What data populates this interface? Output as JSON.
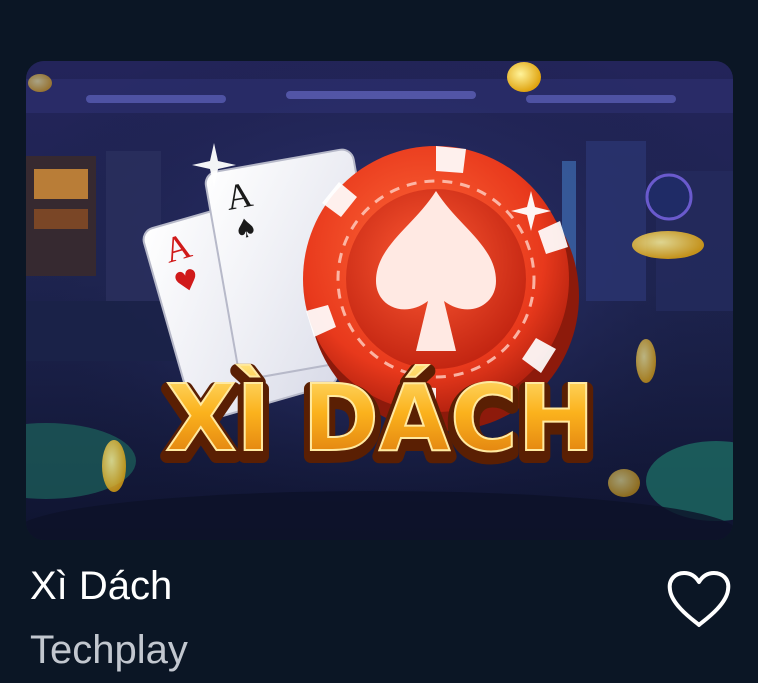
{
  "game": {
    "title": "Xì Dách",
    "provider": "Techplay",
    "thumbnail": {
      "logo_text": "XÌ DÁCH",
      "card_rank": "A"
    }
  },
  "icons": {
    "favorite": "heart-outline-icon"
  },
  "colors": {
    "page_bg": "#0b1625",
    "title_text": "#ffffff",
    "provider_text": "#c2c7cf",
    "logo_gold": "#f7a81b",
    "chip_red": "#e8391c"
  }
}
